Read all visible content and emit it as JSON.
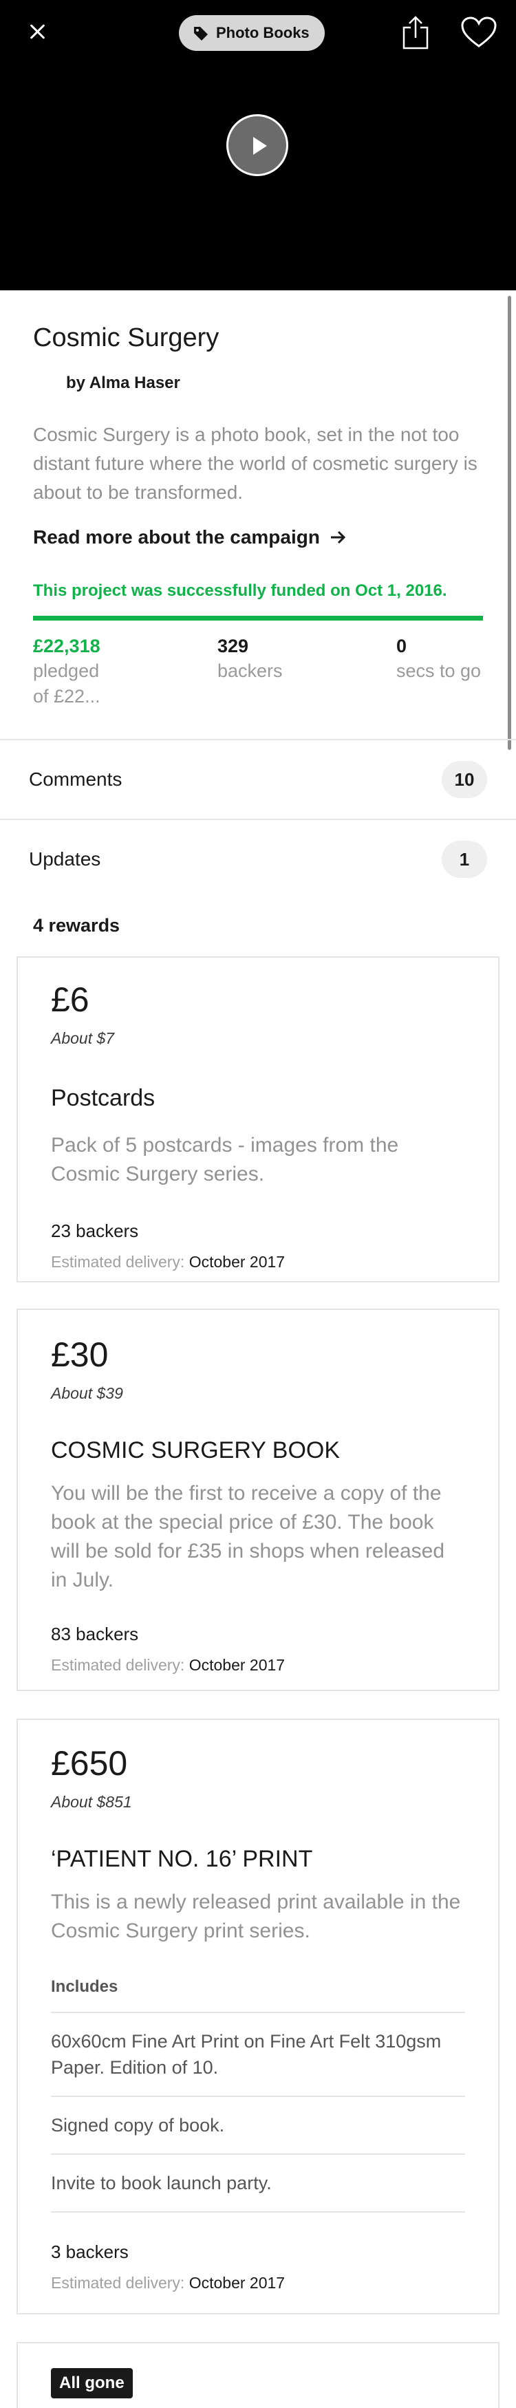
{
  "video": {
    "category_label": "Photo Books"
  },
  "project": {
    "title": "Cosmic Surgery",
    "creator": "by Alma Haser",
    "blurb": "Cosmic Surgery is a photo book, set in the not too distant future where the world of cosmetic surgery is about to be transformed.",
    "read_more": "Read more about the campaign",
    "funded_text": "This project was successfully funded on Oct 1, 2016.",
    "progress_percent": 100,
    "stats": {
      "pledged_value": "£22,318",
      "pledged_label_1": "pledged",
      "pledged_label_2": "of £22...",
      "backers_value": "329",
      "backers_label": "backers",
      "time_value": "0",
      "time_label": "secs to go"
    }
  },
  "rows": {
    "comments_label": "Comments",
    "comments_count": "10",
    "updates_label": "Updates",
    "updates_count": "1"
  },
  "rewards_heading": "4 rewards",
  "rewards": [
    {
      "amount": "£6",
      "about": "About $7",
      "title": "Postcards",
      "description": "Pack of 5 postcards - images from the Cosmic Surgery series.",
      "backers": "23 backers",
      "delivery_label": "Estimated delivery:",
      "delivery_date": "October 2017"
    },
    {
      "amount": "£30",
      "about": "About $39",
      "title": "COSMIC SURGERY BOOK",
      "description": "You will be the first to receive a copy of the book at the special price of £30. The book will be sold for £35 in shops when released in July.",
      "backers": "83 backers",
      "delivery_label": "Estimated delivery:",
      "delivery_date": "October 2017"
    },
    {
      "amount": "£650",
      "about": "About $851",
      "title": "‘PATIENT NO. 16’ PRINT",
      "description": "This is a newly released print available in the Cosmic Surgery print series.",
      "includes_heading": "Includes",
      "includes": [
        "60x60cm Fine Art Print on Fine Art Felt 310gsm Paper. Edition of 10.",
        "Signed copy of book.",
        "Invite to book launch party."
      ],
      "backers": "3 backers",
      "delivery_label": "Estimated delivery:",
      "delivery_date": "October 2017"
    },
    {
      "badge": "All gone"
    }
  ],
  "colors": {
    "success_green": "#12b24a",
    "video_background": "#000000",
    "pill_background": "#efefef"
  },
  "icons": [
    "close-icon",
    "tag-icon",
    "share-icon",
    "heart-icon",
    "play-icon",
    "arrow-right-icon"
  ]
}
